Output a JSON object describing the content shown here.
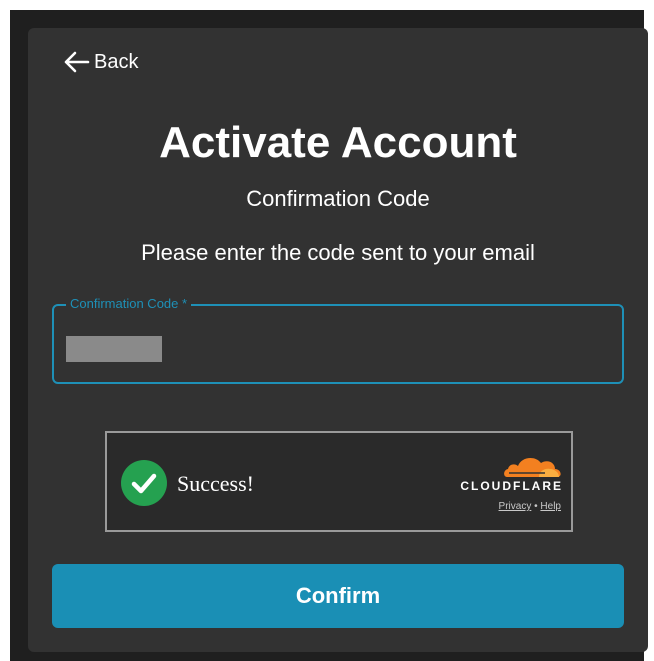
{
  "back": {
    "label": "Back"
  },
  "header": {
    "title": "Activate Account",
    "subtitle": "Confirmation Code",
    "instruction": "Please enter the code sent to your email"
  },
  "form": {
    "code_field": {
      "label": "Confirmation Code *",
      "value": ""
    }
  },
  "captcha": {
    "status": "Success!",
    "provider": "CLOUDFLARE",
    "privacy_link": "Privacy",
    "separator": "•",
    "help_link": "Help",
    "status_icon": "check-icon",
    "logo_icon": "cloudflare-cloud-icon"
  },
  "confirm": {
    "label": "Confirm"
  },
  "colors": {
    "background": "#1f1f1f",
    "card": "#323232",
    "accent": "#1a8fb5",
    "success": "#25a150",
    "cloudflare_orange": "#f38020"
  }
}
